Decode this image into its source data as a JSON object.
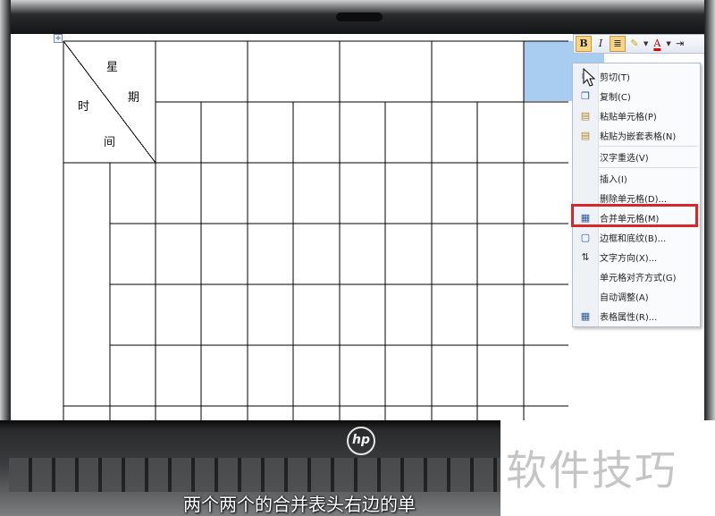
{
  "document": {
    "table_handle_icon": "move-cross-icon",
    "header_cell": {
      "weekday_char_1": "星",
      "weekday_char_2": "期",
      "time_char_1": "时",
      "time_char_2": "间"
    }
  },
  "mini_toolbar": {
    "bold_label": "B",
    "italic_label": "I",
    "align_icon": "align-center-icon",
    "highlight_icon": "highlight-pen-icon",
    "font_color_label": "A",
    "indent_icon": "indent-icon"
  },
  "context_menu": {
    "items": [
      {
        "label": "剪切(T)",
        "icon": "scissors-icon"
      },
      {
        "label": "复制(C)",
        "icon": "copy-icon"
      },
      {
        "label": "粘贴单元格(P)",
        "icon": "paste-icon"
      },
      {
        "label": "粘贴为嵌套表格(N)",
        "icon": "paste-nested-icon"
      },
      {
        "label": "汉字重选(V)",
        "icon": ""
      },
      {
        "label": "插入(I)",
        "icon": ""
      },
      {
        "label": "删除单元格(D)...",
        "icon": ""
      },
      {
        "label": "合并单元格(M)",
        "icon": "merge-cells-icon"
      },
      {
        "label": "边框和底纹(B)...",
        "icon": "borders-icon"
      },
      {
        "label": "文字方向(X)...",
        "icon": "text-direction-icon"
      },
      {
        "label": "单元格对齐方式(G)",
        "icon": ""
      },
      {
        "label": "自动调整(A)",
        "icon": ""
      },
      {
        "label": "表格属性(R)...",
        "icon": "table-properties-icon"
      }
    ],
    "highlighted_item": "合并单元格(M)",
    "highlight_color": "#d8262a"
  },
  "laptop": {
    "brand_logo": "hp"
  },
  "overlay": {
    "watermark": "软件技巧",
    "subtitle": "两个两个的合并表头右边的单"
  },
  "colors": {
    "selected_cell": "#a9cdf0",
    "table_lines": "#000000"
  }
}
